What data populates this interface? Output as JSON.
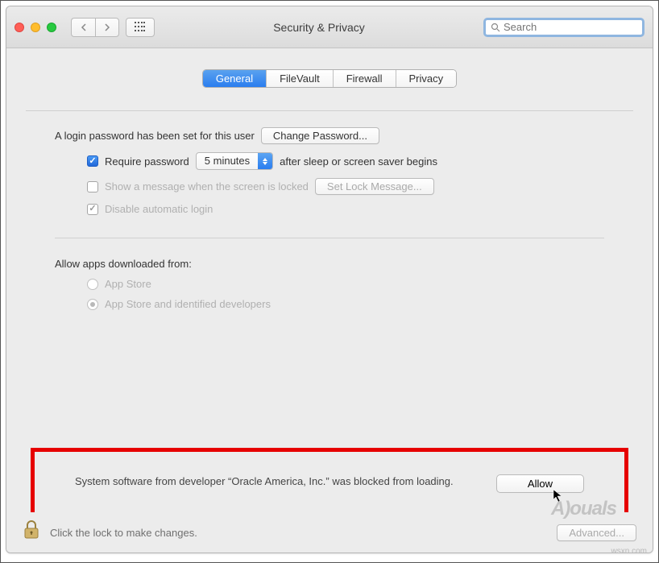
{
  "window": {
    "title": "Security & Privacy"
  },
  "search": {
    "placeholder": "Search"
  },
  "tabs": {
    "general": "General",
    "filevault": "FileVault",
    "firewall": "Firewall",
    "privacy": "Privacy"
  },
  "login_section": {
    "password_set_label": "A login password has been set for this user",
    "change_password_btn": "Change Password...",
    "require_password": {
      "label_before": "Require password",
      "delay": "5 minutes",
      "label_after": "after sleep or screen saver begins"
    },
    "show_message": {
      "label": "Show a message when the screen is locked",
      "button": "Set Lock Message..."
    },
    "disable_auto_login": "Disable automatic login"
  },
  "download_section": {
    "heading": "Allow apps downloaded from:",
    "option_appstore": "App Store",
    "option_identified": "App Store and identified developers"
  },
  "blocked": {
    "text": "System software from developer “Oracle America, Inc.” was blocked from loading.",
    "allow_btn": "Allow"
  },
  "footer": {
    "lock_text": "Click the lock to make changes.",
    "advanced_btn": "Advanced..."
  },
  "watermark": "A)ouals",
  "corner": "wsxn.com"
}
